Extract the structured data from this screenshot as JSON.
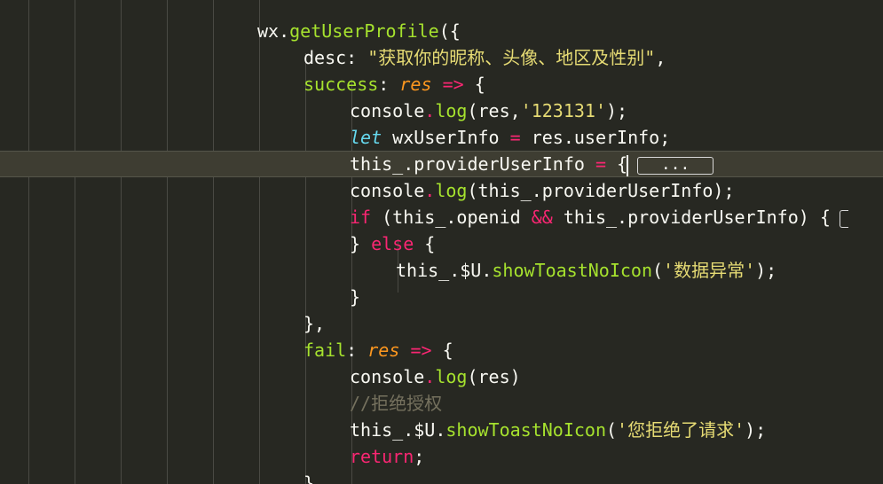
{
  "editor": {
    "lines": [
      {
        "indent": 0,
        "text": ""
      },
      {
        "indent": 0,
        "tokens": [
          [
            "plain",
            "wx."
          ],
          [
            "fn",
            "getUserProfile"
          ],
          [
            "plain",
            "({"
          ]
        ]
      },
      {
        "indent": 1,
        "tokens": [
          [
            "plain",
            "desc: "
          ],
          [
            "str",
            "\"获取你的昵称、头像、地区及性别\""
          ],
          [
            "plain",
            ","
          ]
        ]
      },
      {
        "indent": 1,
        "tokens": [
          [
            "fn",
            "success"
          ],
          [
            "plain",
            ": "
          ],
          [
            "param",
            "res"
          ],
          [
            "plain",
            " "
          ],
          [
            "kw",
            "=>"
          ],
          [
            "plain",
            " {"
          ]
        ]
      },
      {
        "indent": 2,
        "tokens": [
          [
            "plain",
            "console"
          ],
          [
            "kw",
            "."
          ],
          [
            "fn",
            "log"
          ],
          [
            "plain",
            "(res,"
          ],
          [
            "str",
            "'123131'"
          ],
          [
            "plain",
            ");"
          ]
        ]
      },
      {
        "indent": 2,
        "tokens": [
          [
            "store",
            "let"
          ],
          [
            "plain",
            " wxUserInfo "
          ],
          [
            "kw",
            "="
          ],
          [
            "plain",
            " res.userInfo;"
          ]
        ]
      },
      {
        "indent": 2,
        "current": true,
        "tokens": [
          [
            "plain",
            "this_.providerUserInfo "
          ],
          [
            "kw",
            "="
          ],
          [
            "plain",
            " {"
          ]
        ],
        "cursor": true,
        "fold": "..."
      },
      {
        "indent": 2,
        "tokens": [
          [
            "plain",
            "console"
          ],
          [
            "kw",
            "."
          ],
          [
            "fn",
            "log"
          ],
          [
            "plain",
            "(this_.providerUserInfo);"
          ]
        ]
      },
      {
        "indent": 2,
        "tokens": [
          [
            "kw",
            "if"
          ],
          [
            "plain",
            " (this_.openid "
          ],
          [
            "kw",
            "&&"
          ],
          [
            "plain",
            " this_.providerUserInfo) {"
          ]
        ],
        "foldEdge": true
      },
      {
        "indent": 2,
        "tokens": [
          [
            "plain",
            "} "
          ],
          [
            "kw",
            "else"
          ],
          [
            "plain",
            " {"
          ]
        ]
      },
      {
        "indent": 3,
        "tokens": [
          [
            "plain",
            "this_.$U."
          ],
          [
            "fn",
            "showToastNoIcon"
          ],
          [
            "plain",
            "("
          ],
          [
            "str",
            "'数据异常'"
          ],
          [
            "plain",
            ");"
          ]
        ]
      },
      {
        "indent": 2,
        "tokens": [
          [
            "plain",
            "}"
          ]
        ]
      },
      {
        "indent": 1,
        "tokens": [
          [
            "plain",
            "},"
          ]
        ]
      },
      {
        "indent": 1,
        "tokens": [
          [
            "fn",
            "fail"
          ],
          [
            "plain",
            ": "
          ],
          [
            "param",
            "res"
          ],
          [
            "plain",
            " "
          ],
          [
            "kw",
            "=>"
          ],
          [
            "plain",
            " {"
          ]
        ]
      },
      {
        "indent": 2,
        "tokens": [
          [
            "plain",
            "console"
          ],
          [
            "kw",
            "."
          ],
          [
            "fn",
            "log"
          ],
          [
            "plain",
            "(res)"
          ]
        ]
      },
      {
        "indent": 2,
        "tokens": [
          [
            "comment",
            "//拒绝授权"
          ]
        ]
      },
      {
        "indent": 2,
        "tokens": [
          [
            "plain",
            "this_.$U."
          ],
          [
            "fn",
            "showToastNoIcon"
          ],
          [
            "plain",
            "("
          ],
          [
            "str",
            "'您拒绝了请求'"
          ],
          [
            "plain",
            ");"
          ]
        ]
      },
      {
        "indent": 2,
        "tokens": [
          [
            "kw",
            "return"
          ],
          [
            "plain",
            ";"
          ]
        ]
      },
      {
        "indent": 1,
        "tokens": [
          [
            "plain",
            "}"
          ]
        ]
      }
    ]
  }
}
